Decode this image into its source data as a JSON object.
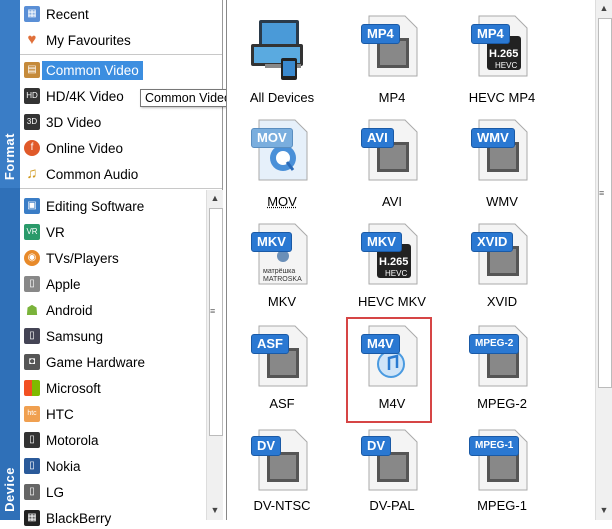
{
  "sidebar_tabs": {
    "format": "Format",
    "device": "Device"
  },
  "format_list": [
    {
      "label": "Recent",
      "icon": "recent-icon"
    },
    {
      "label": "My Favourites",
      "icon": "heart-icon"
    },
    {
      "label": "Common Video",
      "icon": "film-icon",
      "selected": true
    },
    {
      "label": "HD/4K Video",
      "icon": "hd-icon"
    },
    {
      "label": "3D Video",
      "icon": "3d-icon"
    },
    {
      "label": "Online Video",
      "icon": "online-video-icon"
    },
    {
      "label": "Common Audio",
      "icon": "music-note-icon"
    }
  ],
  "device_list": [
    {
      "label": "Editing Software"
    },
    {
      "label": "VR"
    },
    {
      "label": "TVs/Players"
    },
    {
      "label": "Apple"
    },
    {
      "label": "Android"
    },
    {
      "label": "Samsung"
    },
    {
      "label": "Game Hardware"
    },
    {
      "label": "Microsoft"
    },
    {
      "label": "HTC"
    },
    {
      "label": "Motorola"
    },
    {
      "label": "Nokia"
    },
    {
      "label": "LG"
    },
    {
      "label": "BlackBerry"
    }
  ],
  "tooltip": "Common Video",
  "formats": [
    {
      "caption": "All Devices",
      "badge": ""
    },
    {
      "caption": "MP4",
      "badge": "MP4"
    },
    {
      "caption": "HEVC MP4",
      "badge": "MP4",
      "sub": "H.265",
      "sub2": "HEVC"
    },
    {
      "caption": "MOV",
      "badge": "MOV"
    },
    {
      "caption": "AVI",
      "badge": "AVI"
    },
    {
      "caption": "WMV",
      "badge": "WMV"
    },
    {
      "caption": "MKV",
      "badge": "MKV",
      "sub": "матрёшка",
      "sub2": "MATROSKA"
    },
    {
      "caption": "HEVC MKV",
      "badge": "MKV",
      "sub": "H.265",
      "sub2": "HEVC"
    },
    {
      "caption": "XVID",
      "badge": "XVID"
    },
    {
      "caption": "ASF",
      "badge": "ASF"
    },
    {
      "caption": "M4V",
      "badge": "M4V",
      "selected": true
    },
    {
      "caption": "MPEG-2",
      "badge": "MPEG-2"
    },
    {
      "caption": "DV-NTSC",
      "badge": "DV"
    },
    {
      "caption": "DV-PAL",
      "badge": "DV"
    },
    {
      "caption": "MPEG-1",
      "badge": "MPEG-1"
    }
  ],
  "colors": {
    "accent": "#3c8ee0",
    "tab": "#3a7dc6",
    "badge": "#2a78d2",
    "selection_border": "#d64545"
  }
}
